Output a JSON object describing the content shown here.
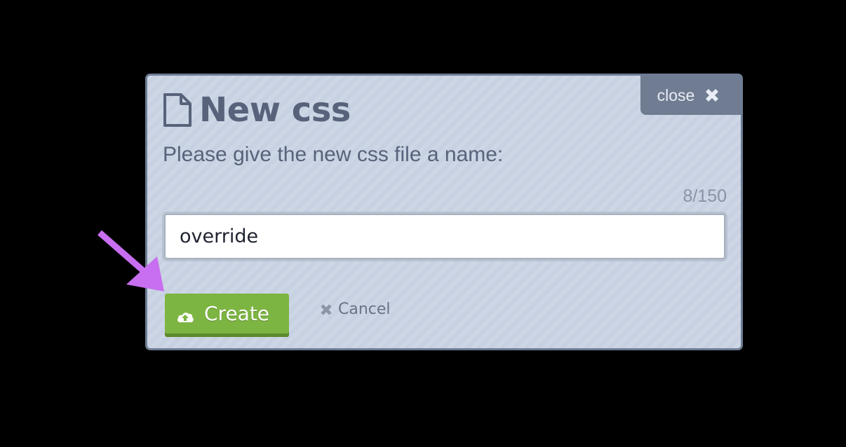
{
  "dialog": {
    "title": "New css",
    "prompt": "Please give the new css file a name:",
    "counter": "8/150",
    "close_label": "close",
    "input": {
      "value": "override",
      "placeholder": ""
    },
    "create_label": "Create",
    "cancel_label": "Cancel"
  },
  "icons": {
    "title_icon": "file-icon",
    "close_icon": "close-x-icon",
    "create_icon": "cloud-upload-icon",
    "cancel_icon": "close-x-icon"
  },
  "colors": {
    "dialog_bg": "#c7d1e2",
    "dialog_border": "#6e7d95",
    "title_text": "#58627a",
    "close_bg": "#6f7c91",
    "create_bg": "#7db542",
    "annotation_arrow": "#c86ef0"
  }
}
